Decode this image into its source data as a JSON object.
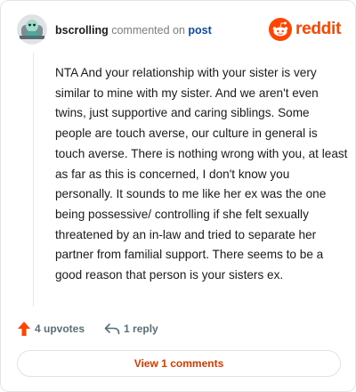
{
  "header": {
    "author": "bscrolling",
    "verb": "commented on",
    "link": "post",
    "brand": "reddit"
  },
  "comment": {
    "body": "NTA And your relationship with your sister is very similar to mine with my sister. And we aren't even twins, just supportive and caring siblings. Some people are touch averse, our culture in general is touch averse. There is nothing wrong with you, at least as far as this is concerned, I don't know you personally. It sounds to me like her ex was the one being possessive/ controlling if she felt sexually threatened by an in-law and tried to separate her partner from familial support. There seems to be a good reason that person is your sisters ex."
  },
  "actions": {
    "upvotes": "4 upvotes",
    "replies": "1 reply"
  },
  "view_comments": "View 1 comments",
  "colors": {
    "brand": "#ff4500",
    "link": "#0e4ca1",
    "view_button_text": "#d93a00"
  },
  "icons": [
    "avatar-snoo",
    "reddit-logo-icon",
    "upvote-arrow-icon",
    "reply-icon"
  ]
}
